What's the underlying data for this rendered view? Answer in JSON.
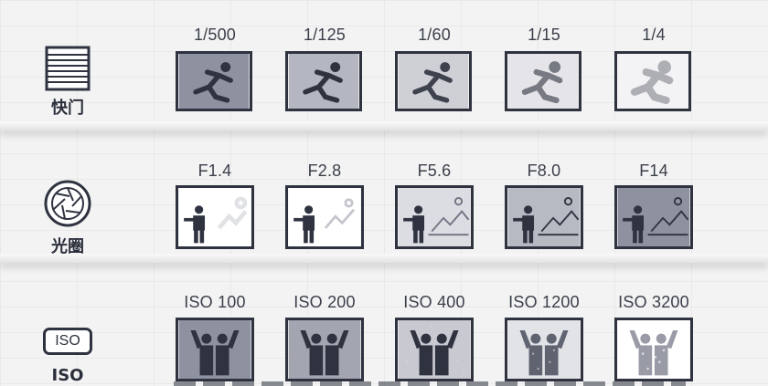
{
  "rows": {
    "shutter": {
      "label": "快门",
      "icon": "shutter-icon",
      "settings": [
        "1/500",
        "1/125",
        "1/60",
        "1/15",
        "1/4"
      ]
    },
    "aperture": {
      "label": "光圈",
      "icon": "aperture-icon",
      "settings": [
        "F1.4",
        "F2.8",
        "F5.6",
        "F8.0",
        "F14"
      ]
    },
    "iso": {
      "label": "ISO",
      "icon": "iso-icon",
      "icon_text": "ISO",
      "settings": [
        "ISO 100",
        "ISO 200",
        "ISO 400",
        "ISO 1200",
        "ISO 3200"
      ]
    }
  },
  "colors": {
    "ink": "#2f3340",
    "shelf": "#e8e8e8"
  }
}
